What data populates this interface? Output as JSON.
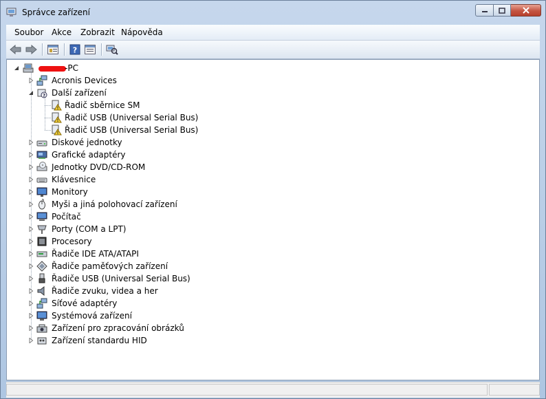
{
  "window": {
    "title": "Správce zařízení"
  },
  "menu": [
    "Soubor",
    "Akce",
    "Zobrazit",
    "Nápověda"
  ],
  "toolbar": [
    {
      "name": "back-icon"
    },
    {
      "name": "forward-icon"
    },
    {
      "name": "properties-icon"
    },
    {
      "name": "help-icon"
    },
    {
      "name": "show-hidden-icon"
    },
    {
      "name": "scan-hardware-icon"
    }
  ],
  "tree": {
    "root": "-PC",
    "categories": [
      {
        "label": "Acronis Devices",
        "icon": "network-icon",
        "expanded": false
      },
      {
        "label": "Další zařízení",
        "icon": "unknown-device-icon",
        "expanded": true,
        "children": [
          {
            "label": "Řadič sběrnice SM",
            "icon": "warning-device-icon"
          },
          {
            "label": "Řadič USB (Universal Serial Bus)",
            "icon": "warning-device-icon"
          },
          {
            "label": "Řadič USB (Universal Serial Bus)",
            "icon": "warning-device-icon"
          }
        ]
      },
      {
        "label": "Diskové jednotky",
        "icon": "disk-drive-icon",
        "expanded": false
      },
      {
        "label": "Grafické adaptéry",
        "icon": "display-adapter-icon",
        "expanded": false
      },
      {
        "label": "Jednotky DVD/CD-ROM",
        "icon": "dvd-drive-icon",
        "expanded": false
      },
      {
        "label": "Klávesnice",
        "icon": "keyboard-icon",
        "expanded": false
      },
      {
        "label": "Monitory",
        "icon": "monitor-icon",
        "expanded": false
      },
      {
        "label": "Myši a jiná polohovací zařízení",
        "icon": "mouse-icon",
        "expanded": false
      },
      {
        "label": "Počítač",
        "icon": "computer-icon",
        "expanded": false
      },
      {
        "label": "Porty (COM a LPT)",
        "icon": "port-icon",
        "expanded": false
      },
      {
        "label": "Procesory",
        "icon": "processor-icon",
        "expanded": false
      },
      {
        "label": "Řadiče IDE ATA/ATAPI",
        "icon": "ide-controller-icon",
        "expanded": false
      },
      {
        "label": "Řadiče paměťových zařízení",
        "icon": "storage-controller-icon",
        "expanded": false
      },
      {
        "label": "Řadiče USB (Universal Serial Bus)",
        "icon": "usb-icon",
        "expanded": false
      },
      {
        "label": "Řadiče zvuku, videa a her",
        "icon": "speaker-icon",
        "expanded": false
      },
      {
        "label": "Síťové adaptéry",
        "icon": "network-adapter-icon",
        "expanded": false
      },
      {
        "label": "Systémová zařízení",
        "icon": "system-device-icon",
        "expanded": false
      },
      {
        "label": "Zařízení pro zpracování obrázků",
        "icon": "imaging-device-icon",
        "expanded": false
      },
      {
        "label": "Zařízení standardu HID",
        "icon": "hid-icon",
        "expanded": false
      }
    ]
  }
}
